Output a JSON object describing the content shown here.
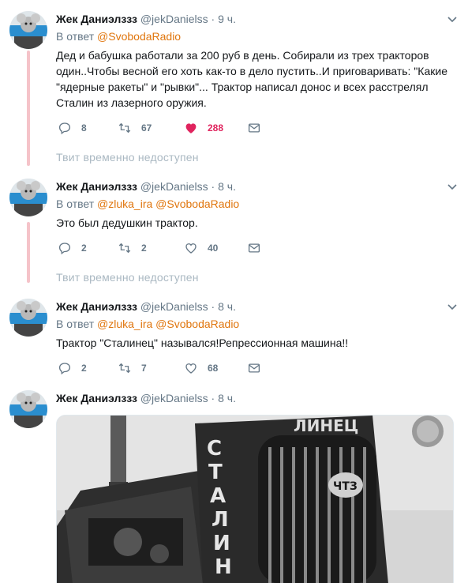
{
  "colors": {
    "accent": "#e0760e",
    "like": "#e0245e",
    "muted": "#657786",
    "thread": "#f5c3c9"
  },
  "tweets": [
    {
      "name": "Жек Даниэлззз",
      "handle": "@jekDanielss",
      "dot": "·",
      "time": "9 ч.",
      "reply_prefix": "В ответ",
      "reply_to": "@SvobodaRadio",
      "text": "Дед и бабушка работали за 200 руб в день. Собирали из трех  тракторов один..Чтобы весной его хоть как-то в дело пустить..И приговаривать: \"Какие \"ядерные ракеты\" и \"рывки\"... Трактор написал донос и всех расстрелял Сталин из лазерного оружия.",
      "replies": "8",
      "retweets": "67",
      "likes": "288",
      "unavailable": "Твит временно недоступен"
    },
    {
      "name": "Жек Даниэлззз",
      "handle": "@jekDanielss",
      "dot": "·",
      "time": "8 ч.",
      "reply_prefix": "В ответ",
      "reply_to": "@zluka_ira @SvobodaRadio",
      "text": "Это был дедушкин трактор.",
      "replies": "2",
      "retweets": "2",
      "likes": "40",
      "unavailable": "Твит временно недоступен"
    },
    {
      "name": "Жек Даниэлззз",
      "handle": "@jekDanielss",
      "dot": "·",
      "time": "8 ч.",
      "reply_prefix": "В ответ",
      "reply_to": "@zluka_ira @SvobodaRadio",
      "text": "Трактор \"Сталинец\" назывался!Репрессионная машина!!",
      "replies": "2",
      "retweets": "7",
      "likes": "68"
    },
    {
      "name": "Жек Даниэлззз",
      "handle": "@jekDanielss",
      "dot": "·",
      "time": "8 ч.",
      "media_alt": "СТАЛИНЕЦ ЧТЗ"
    }
  ]
}
